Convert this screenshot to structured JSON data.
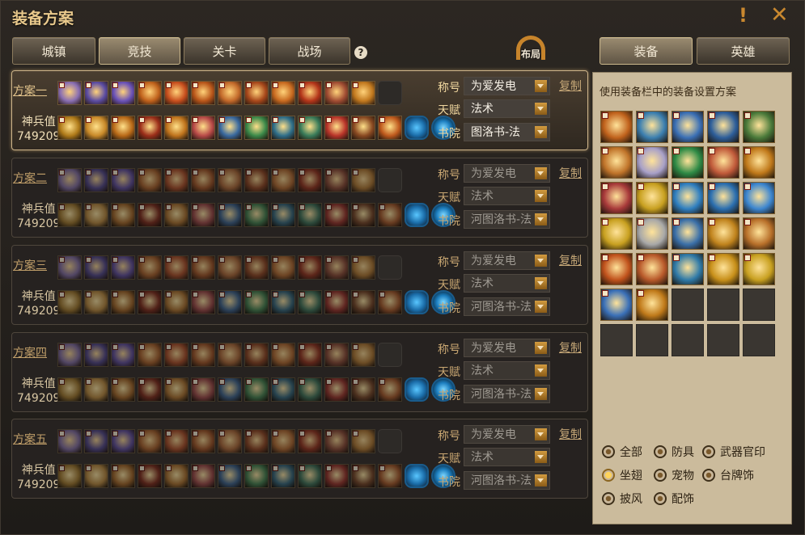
{
  "window": {
    "title": "装备方案"
  },
  "tabs": [
    {
      "label": "城镇",
      "active": false
    },
    {
      "label": "竞技",
      "active": true
    },
    {
      "label": "关卡",
      "active": false
    },
    {
      "label": "战场",
      "active": false
    }
  ],
  "help_icon": "?",
  "layout_button": {
    "label": "布局"
  },
  "right_tabs": [
    {
      "label": "装备",
      "active": true
    },
    {
      "label": "英雄",
      "active": false
    }
  ],
  "field_labels": {
    "title": "称号",
    "talent": "天赋",
    "academy": "书院"
  },
  "copy_label": "复制",
  "power_label": "神兵值",
  "schemes": [
    {
      "name": "方案一",
      "power": "749209",
      "title": "为爱发电",
      "talent": "法术",
      "academy": "图洛书-法",
      "active": true
    },
    {
      "name": "方案二",
      "power": "749209",
      "title": "为爱发电",
      "talent": "法术",
      "academy": "河图洛书-法",
      "active": false
    },
    {
      "name": "方案三",
      "power": "749209",
      "title": "为爱发电",
      "talent": "法术",
      "academy": "河图洛书-法",
      "active": false
    },
    {
      "name": "方案四",
      "power": "749209",
      "title": "为爱发电",
      "talent": "法术",
      "academy": "河图洛书-法",
      "active": false
    },
    {
      "name": "方案五",
      "power": "749209",
      "title": "为爱发电",
      "talent": "法术",
      "academy": "河图洛书-法",
      "active": false
    }
  ],
  "right_panel": {
    "hint": "使用装备栏中的装备设置方案",
    "filters": [
      {
        "label": "全部",
        "selected": false
      },
      {
        "label": "防具",
        "selected": false
      },
      {
        "label": "武器官印",
        "selected": false
      },
      {
        "label": "坐翅",
        "selected": true
      },
      {
        "label": "宠物",
        "selected": false
      },
      {
        "label": "台牌饰",
        "selected": false
      },
      {
        "label": "披风",
        "selected": false
      },
      {
        "label": "配饰",
        "selected": false
      }
    ]
  },
  "colors": {
    "accent": "#c7842b",
    "panel_bg": "#cbbb9c",
    "window_bg": "#2c2722",
    "title_text": "#e9c98c"
  }
}
